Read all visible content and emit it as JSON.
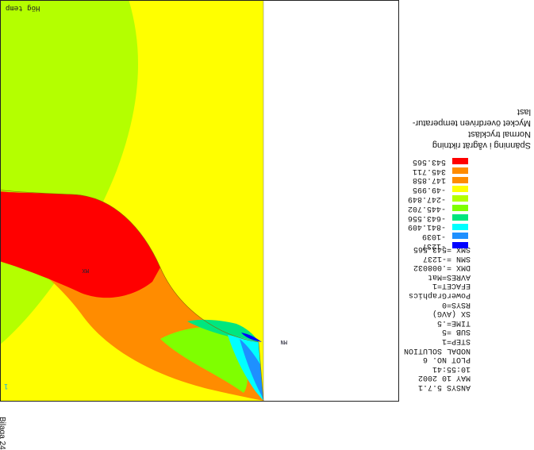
{
  "plot": {
    "corner_label": "Hög temp",
    "triad_label": "1",
    "node_marks": [
      "MN",
      "MX"
    ],
    "contour_colors": [
      "#ff0000",
      "#ff8c00",
      "#ffff00",
      "#b4ff00",
      "#7fff00",
      "#00e67f",
      "#00ffff",
      "#1e90ff",
      "#0000ff"
    ]
  },
  "info": {
    "lines": [
      "ANSYS 5.7.1",
      "MAY 10 2002",
      "10:55:41",
      "PLOT NO.    6",
      "NODAL SOLUTION",
      "STEP=1",
      "SUB =5",
      "TIME=.5",
      "SX         (AVG)",
      "RSYS=0",
      "PowerGraphics",
      "EFACET=1",
      "AVRES=Mat",
      "DMX =.008032",
      "SMN =-1237",
      "SMX =543.565"
    ]
  },
  "legend": {
    "items": [
      {
        "value": "-1237",
        "color": "#0000ff"
      },
      {
        "value": "-1039",
        "color": "#1e90ff"
      },
      {
        "value": "-841.409",
        "color": "#00ffff"
      },
      {
        "value": "-643.556",
        "color": "#00e67f"
      },
      {
        "value": "-445.702",
        "color": "#7fff00"
      },
      {
        "value": "-247.849",
        "color": "#b4ff00"
      },
      {
        "value": "-49.995",
        "color": "#ffff00"
      },
      {
        "value": "147.858",
        "color": "#ff8c00"
      },
      {
        "value": "345.711",
        "color": "#ff8c00"
      },
      {
        "value": "543.565",
        "color": "#ff0000"
      }
    ]
  },
  "title_block": {
    "lines": [
      "Spänning i vågrät riktning",
      "Normal tryckläst",
      "Mycket överdriven temperatur-",
      "last"
    ]
  },
  "page_stamp": "Bilaga 24"
}
